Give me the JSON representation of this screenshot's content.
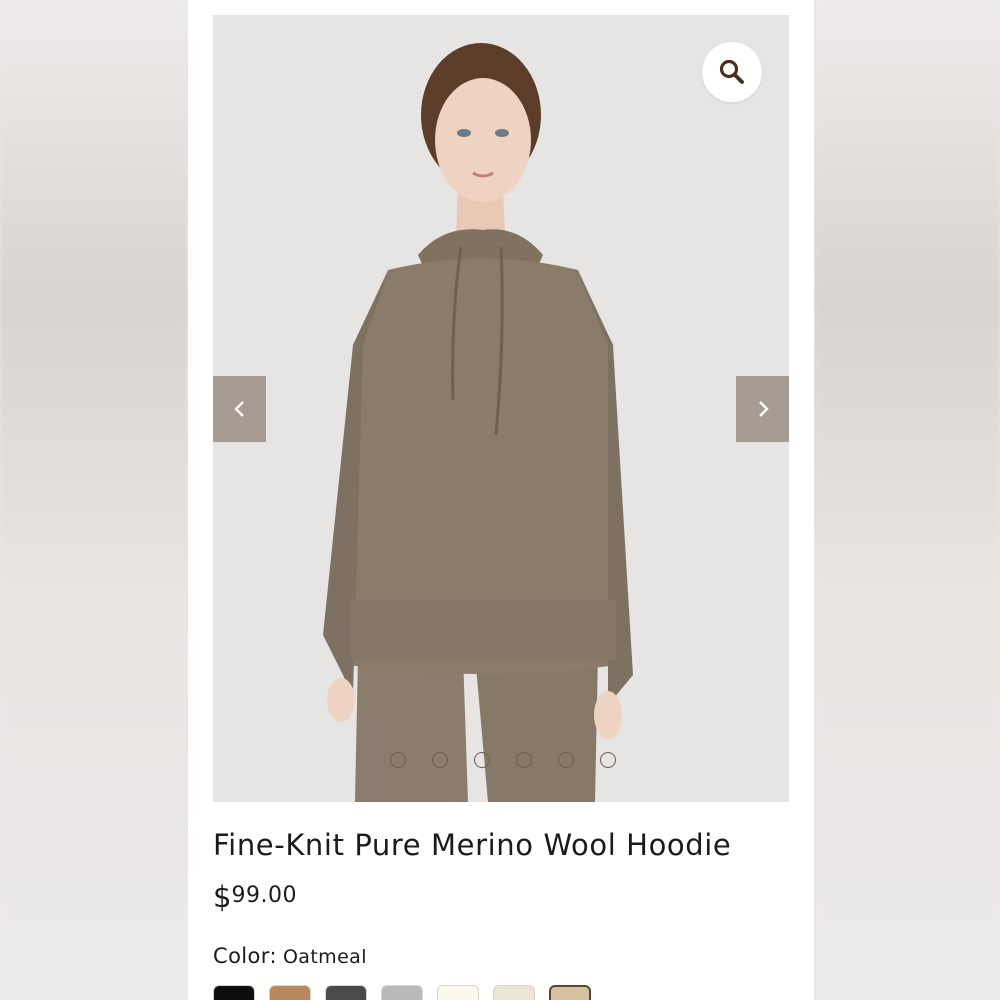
{
  "product": {
    "title": "Fine-Knit Pure Merino Wool Hoodie",
    "price_currency": "$",
    "price_amount": "99.00",
    "color_label": "Color:",
    "color_value": "Oatmeal"
  },
  "gallery": {
    "dot_count": 6,
    "zoom_icon": "search-icon",
    "prev_icon": "chevron-left-icon",
    "next_icon": "chevron-right-icon"
  },
  "swatches": [
    {
      "color": "#0e0e0e",
      "selected": false
    },
    {
      "color": "#b8895c",
      "selected": false
    },
    {
      "color": "#4a4a4a",
      "selected": false
    },
    {
      "color": "#b9b9b9",
      "selected": false
    },
    {
      "color": "#fbf8ee",
      "selected": false
    },
    {
      "color": "#ece6d6",
      "selected": false
    },
    {
      "color": "#d6c2a2",
      "selected": true
    }
  ],
  "colors": {
    "nav_button": "#a79b93",
    "sweater": "#8a7b6b",
    "backdrop": "#e6e5e3"
  }
}
